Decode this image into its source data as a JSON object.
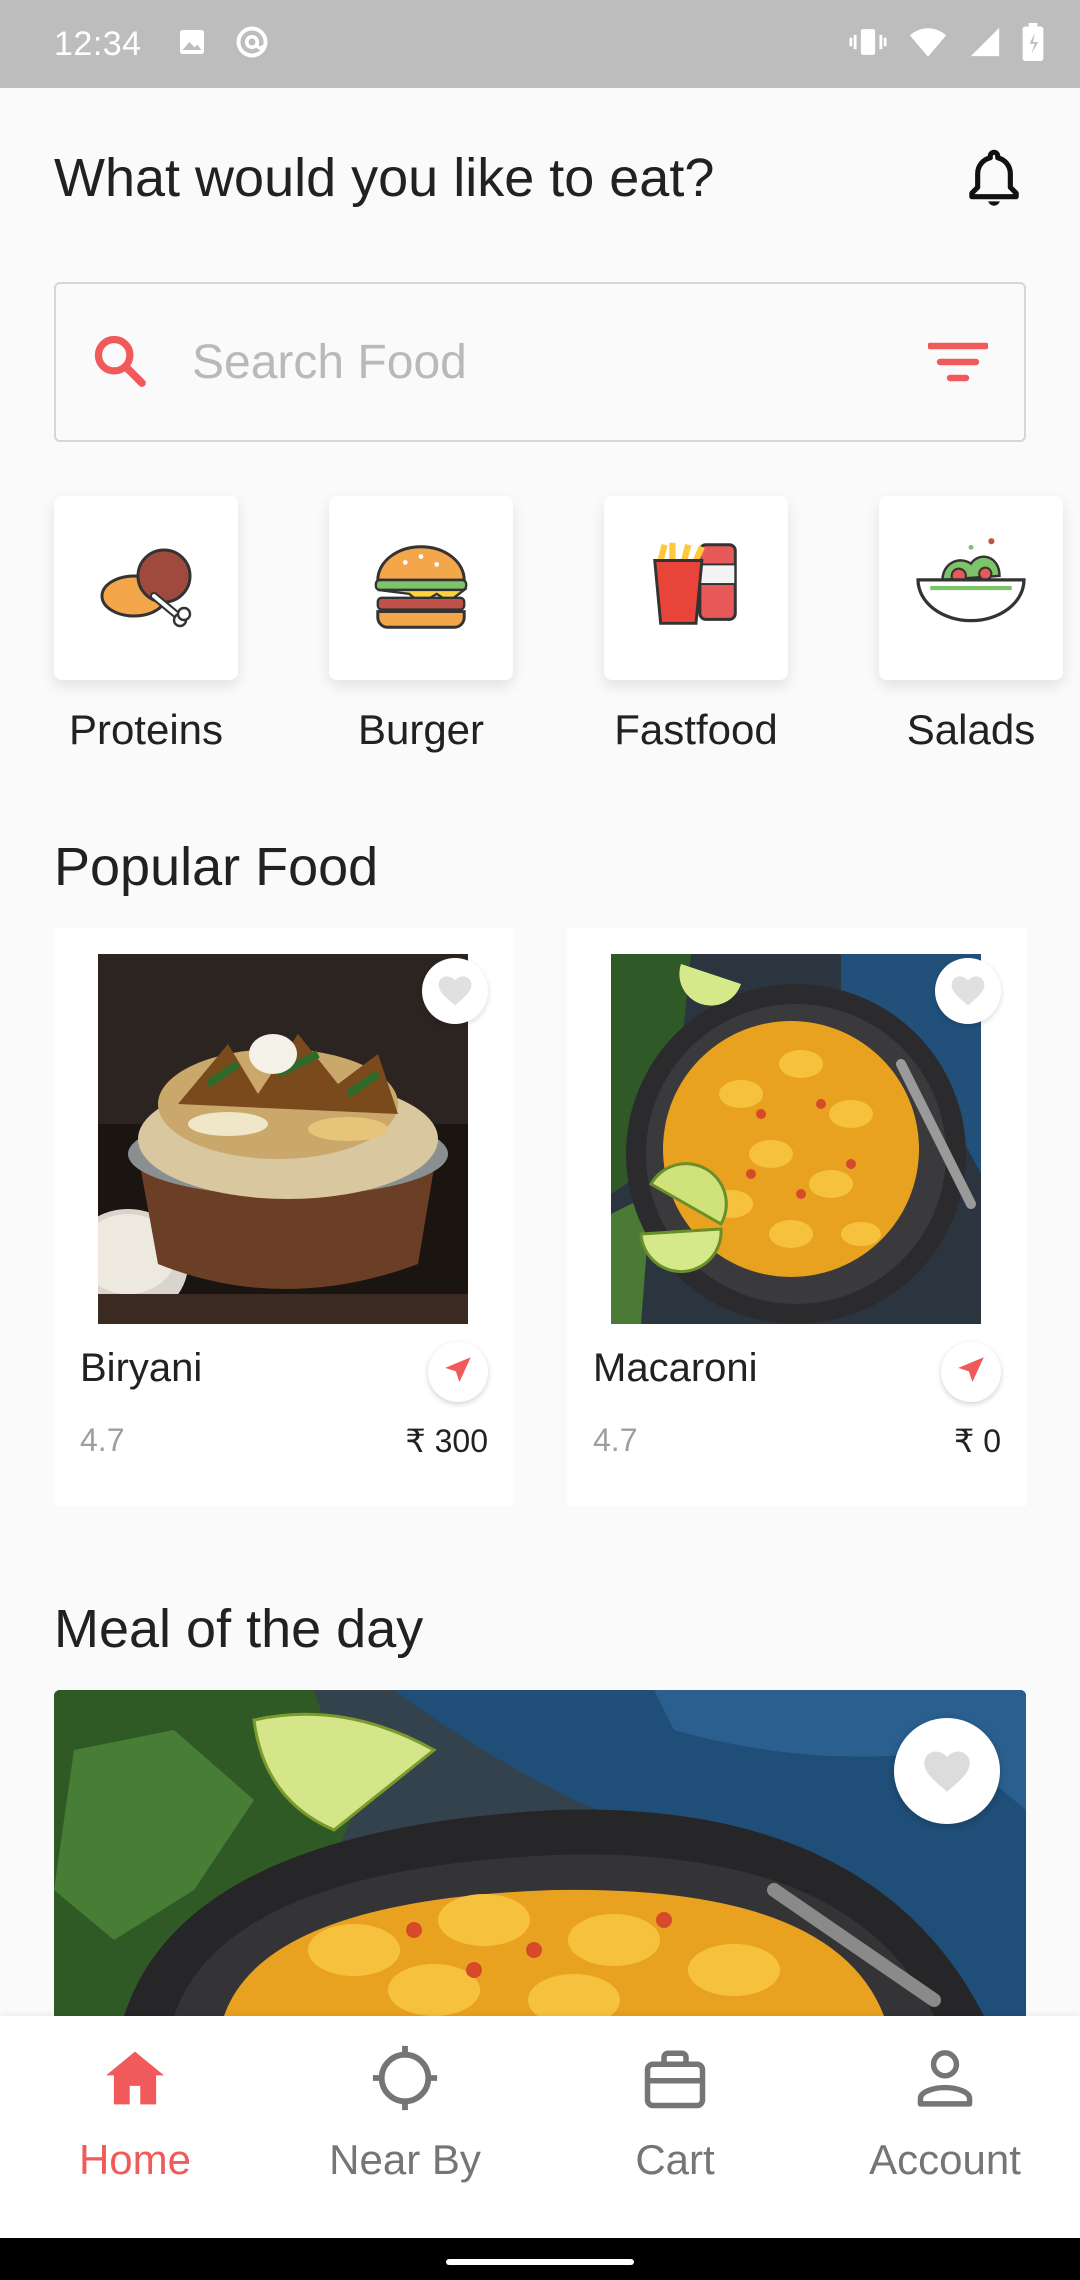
{
  "status_bar": {
    "time": "12:34"
  },
  "header": {
    "title": "What would you like to eat?"
  },
  "search": {
    "placeholder": "Search Food"
  },
  "categories": [
    {
      "label": "Proteins",
      "icon": "drumstick-icon"
    },
    {
      "label": "Burger",
      "icon": "burger-icon"
    },
    {
      "label": "Fastfood",
      "icon": "fries-soda-icon"
    },
    {
      "label": "Salads",
      "icon": "salad-bowl-icon"
    }
  ],
  "popular": {
    "title": "Popular Food",
    "items": [
      {
        "name": "Biryani",
        "rating": "4.7",
        "price": "₹ 300"
      },
      {
        "name": "Macaroni",
        "rating": "4.7",
        "price": "₹ 0"
      }
    ]
  },
  "meal_of_day": {
    "title": "Meal of the day"
  },
  "bottom_nav": [
    {
      "label": "Home",
      "icon": "home-icon",
      "active": true
    },
    {
      "label": "Near By",
      "icon": "crosshair-icon",
      "active": false
    },
    {
      "label": "Cart",
      "icon": "briefcase-icon",
      "active": false
    },
    {
      "label": "Account",
      "icon": "person-icon",
      "active": false
    }
  ],
  "colors": {
    "accent": "#f15a5a",
    "text": "#212121",
    "muted": "#9e9e9e",
    "background": "#fafafa"
  }
}
